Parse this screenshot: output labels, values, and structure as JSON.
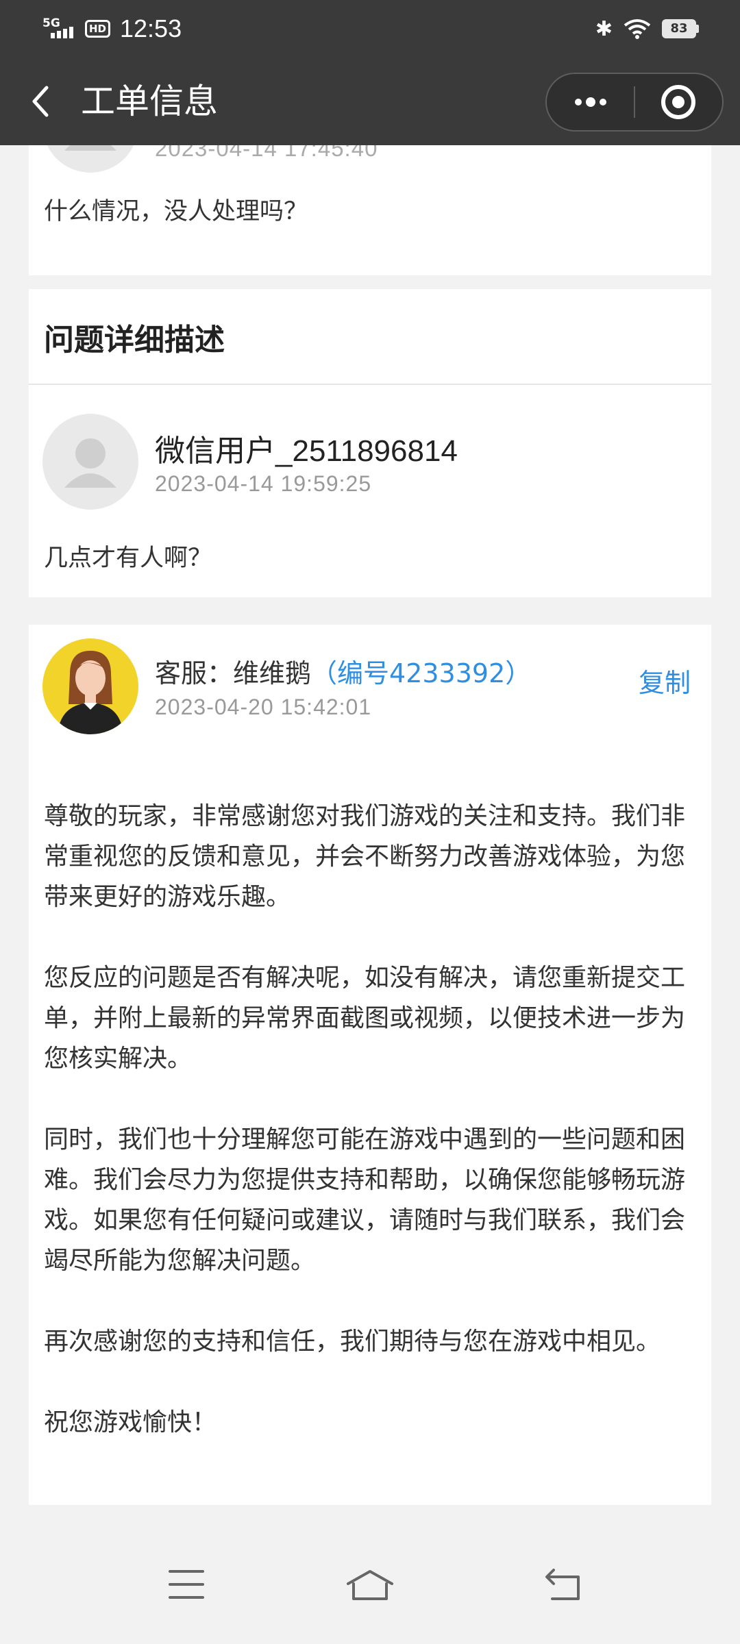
{
  "status_bar": {
    "network": "5G",
    "hd": "HD",
    "time": "12:53",
    "battery": "83"
  },
  "nav": {
    "title": "工单信息"
  },
  "prev_comment": {
    "time": "2023-04-14 17:45:40",
    "text": "什么情况，没人处理吗？"
  },
  "description_section": {
    "title": "问题详细描述",
    "user": "微信用户_2511896814",
    "time": "2023-04-14 19:59:25",
    "text": "几点才有人啊？"
  },
  "reply": {
    "agent": "客服：维维鹅",
    "agent_id": "（编号4233392）",
    "time": "2023-04-20 15:42:01",
    "copy_label": "复制",
    "paragraphs": [
      "尊敬的玩家，非常感谢您对我们游戏的关注和支持。我们非常重视您的反馈和意见，并会不断努力改善游戏体验，为您带来更好的游戏乐趣。",
      "您反应的问题是否有解决呢，如没有解决，请您重新提交工单，并附上最新的异常界面截图或视频，以便技术进一步为您核实解决。",
      "同时，我们也十分理解您可能在游戏中遇到的一些问题和困难。我们会尽力为您提供支持和帮助，以确保您能够畅玩游戏。如果您有任何疑问或建议，请随时与我们联系，我们会竭尽所能为您解决问题。",
      "再次感谢您的支持和信任，我们期待与您在游戏中相见。",
      "祝您游戏愉快！"
    ]
  },
  "colors": {
    "header_bg": "#3a3a3a",
    "link_blue": "#2f8ee0",
    "page_bg": "#f2f2f2"
  },
  "icons": {
    "back": "chevron-left-icon",
    "more": "more-dots-icon",
    "close": "target-close-icon",
    "menu": "menu-icon",
    "home": "home-icon",
    "return": "back-return-icon"
  }
}
